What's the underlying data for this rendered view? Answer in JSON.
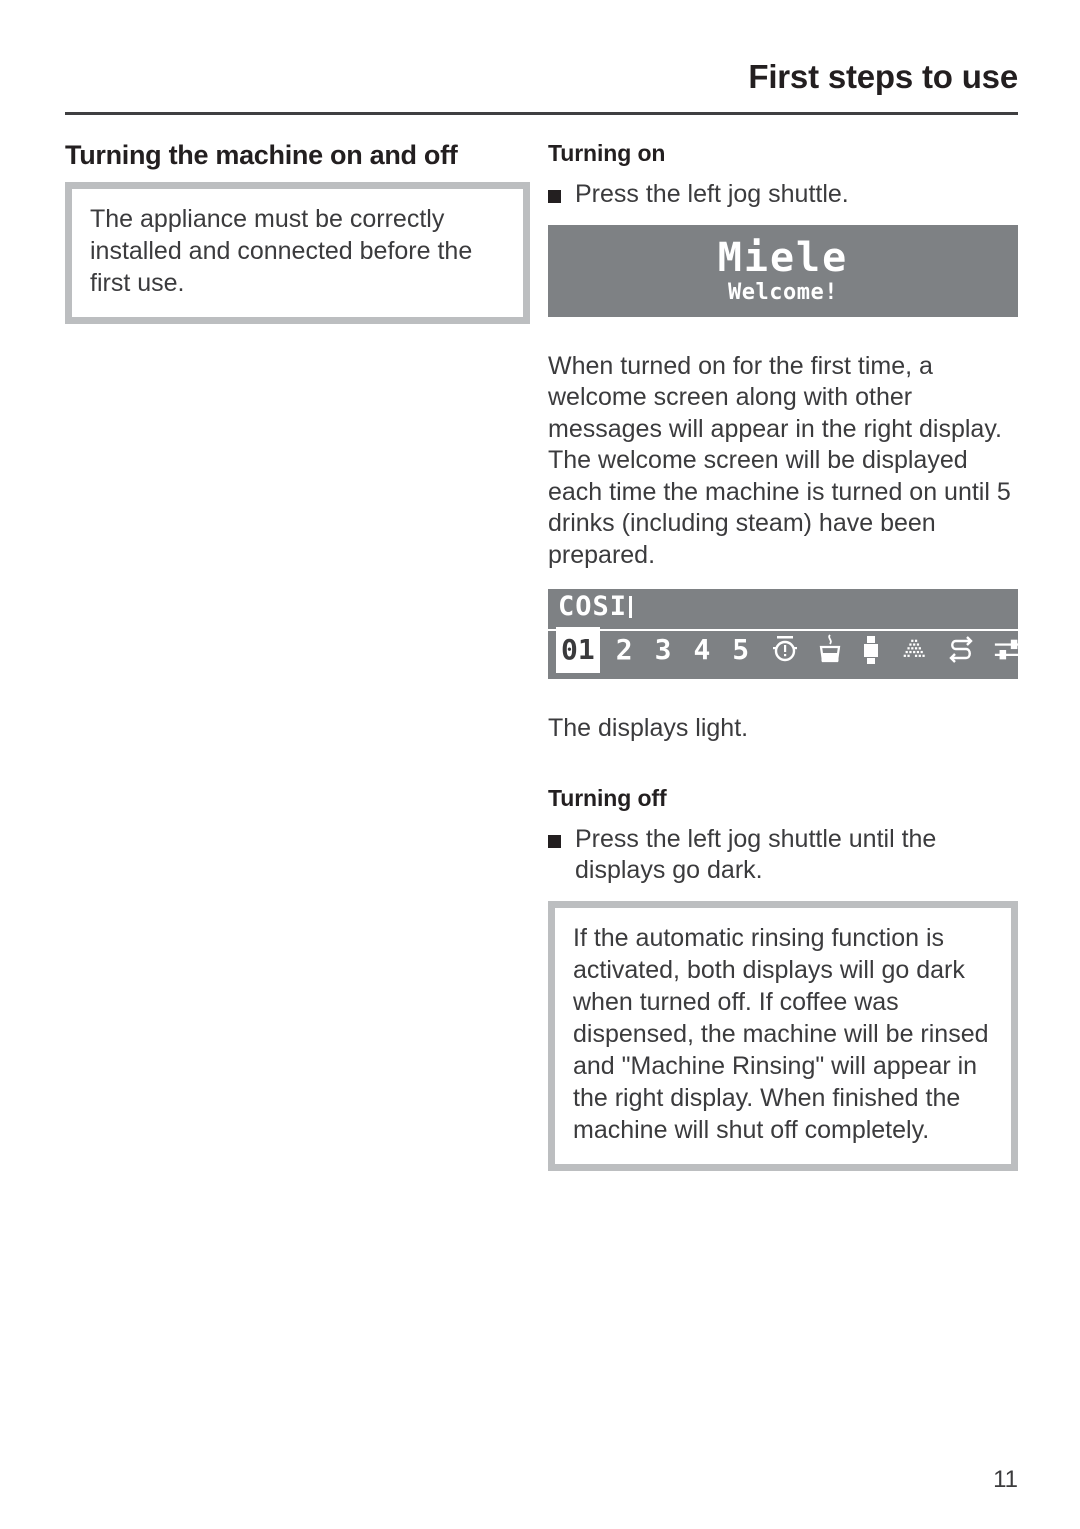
{
  "header": {
    "title": "First steps to use"
  },
  "left_column": {
    "heading": "Turning the machine on and off",
    "note": "The appliance must be correctly installed and connected before the first use."
  },
  "right_column": {
    "turning_on_heading": "Turning on",
    "turning_on_bullet": "Press the left jog shuttle.",
    "welcome_display": {
      "brand": "Miele",
      "message": "Welcome!"
    },
    "paragraph": "When turned on for the first time, a welcome screen along with other messages will appear in the right display. The welcome screen will be displayed each time the machine is turned on until 5 drinks (including steam) have been prepared.",
    "menu_display": {
      "title": "COSI",
      "items": [
        "01",
        "2",
        "3",
        "4",
        "5"
      ],
      "selected_item": "01",
      "icons": [
        "timer-icon",
        "cup-with-steam-icon",
        "portion-size-icon",
        "ground-coffee-icon",
        "rinse-arrow-icon",
        "settings-sliders-icon"
      ]
    },
    "displays_light": "The displays light.",
    "turning_off_heading": "Turning off",
    "turning_off_bullet": "Press the left jog shuttle until the\ndisplays go dark.",
    "note": "If the automatic rinsing function is activated, both displays will go dark when turned off. If coffee was dispensed, the machine will be rinsed and \"Machine Rinsing\" will appear in the right display. When finished the machine will shut off completely."
  },
  "footer": {
    "page_number": "11"
  },
  "colors": {
    "text": "#3b3b3d",
    "heading": "#231f20",
    "note_border": "#bcbec0",
    "lcd_background": "#7e8184",
    "lcd_foreground": "#ffffff",
    "rule": "#3f3f41"
  }
}
